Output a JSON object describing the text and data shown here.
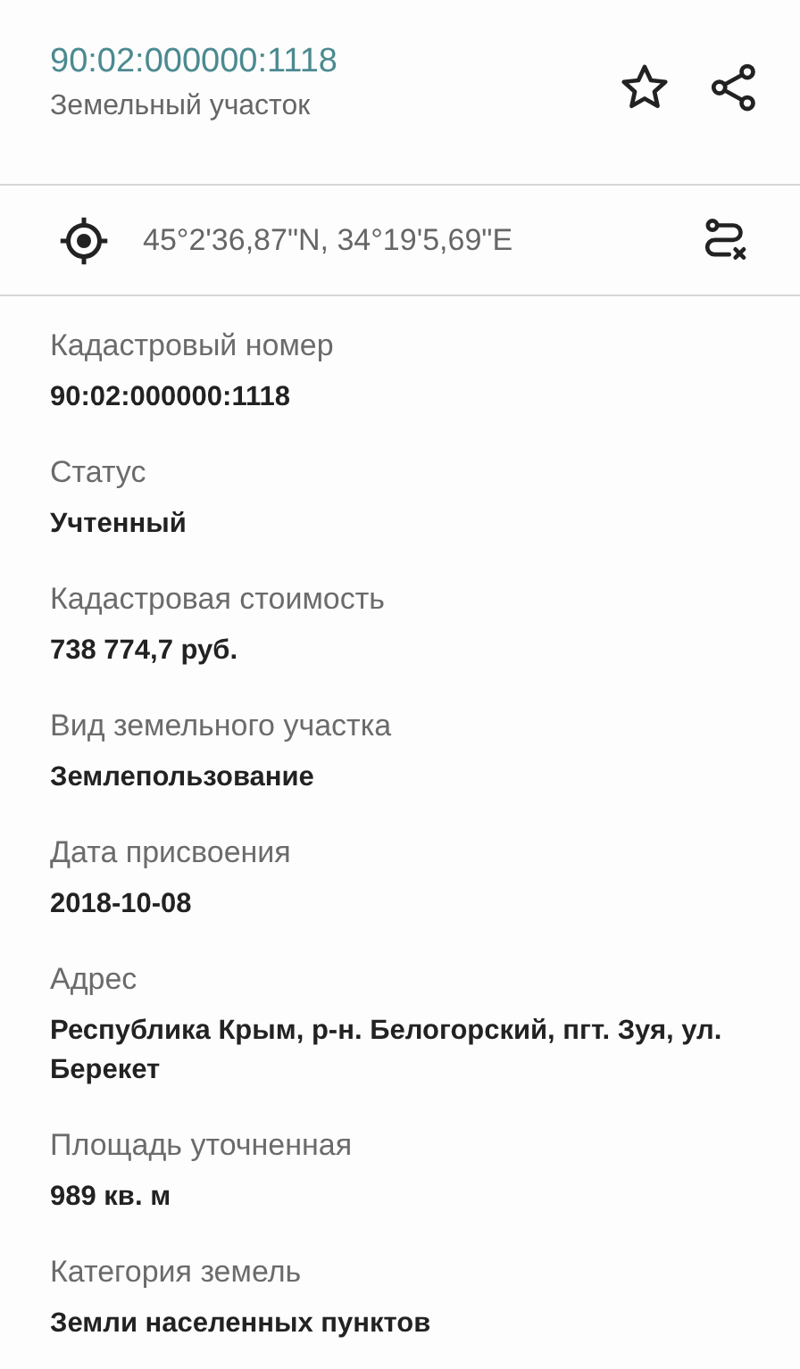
{
  "header": {
    "title": "90:02:000000:1118",
    "subtitle": "Земельный участок"
  },
  "coordinates": "45°2'36,87\"N, 34°19'5,69\"E",
  "fields": [
    {
      "label": "Кадастровый номер",
      "value": "90:02:000000:1118"
    },
    {
      "label": "Статус",
      "value": "Учтенный"
    },
    {
      "label": "Кадастровая стоимость",
      "value": "738 774,7 руб."
    },
    {
      "label": "Вид земельного участка",
      "value": "Землепользование"
    },
    {
      "label": "Дата присвоения",
      "value": "2018-10-08"
    },
    {
      "label": "Адрес",
      "value": "Республика Крым, р-н. Белогорский, пгт. Зуя, ул. Берекет"
    },
    {
      "label": "Площадь уточненная",
      "value": "989 кв. м"
    },
    {
      "label": "Категория земель",
      "value": "Земли населенных пунктов"
    }
  ]
}
